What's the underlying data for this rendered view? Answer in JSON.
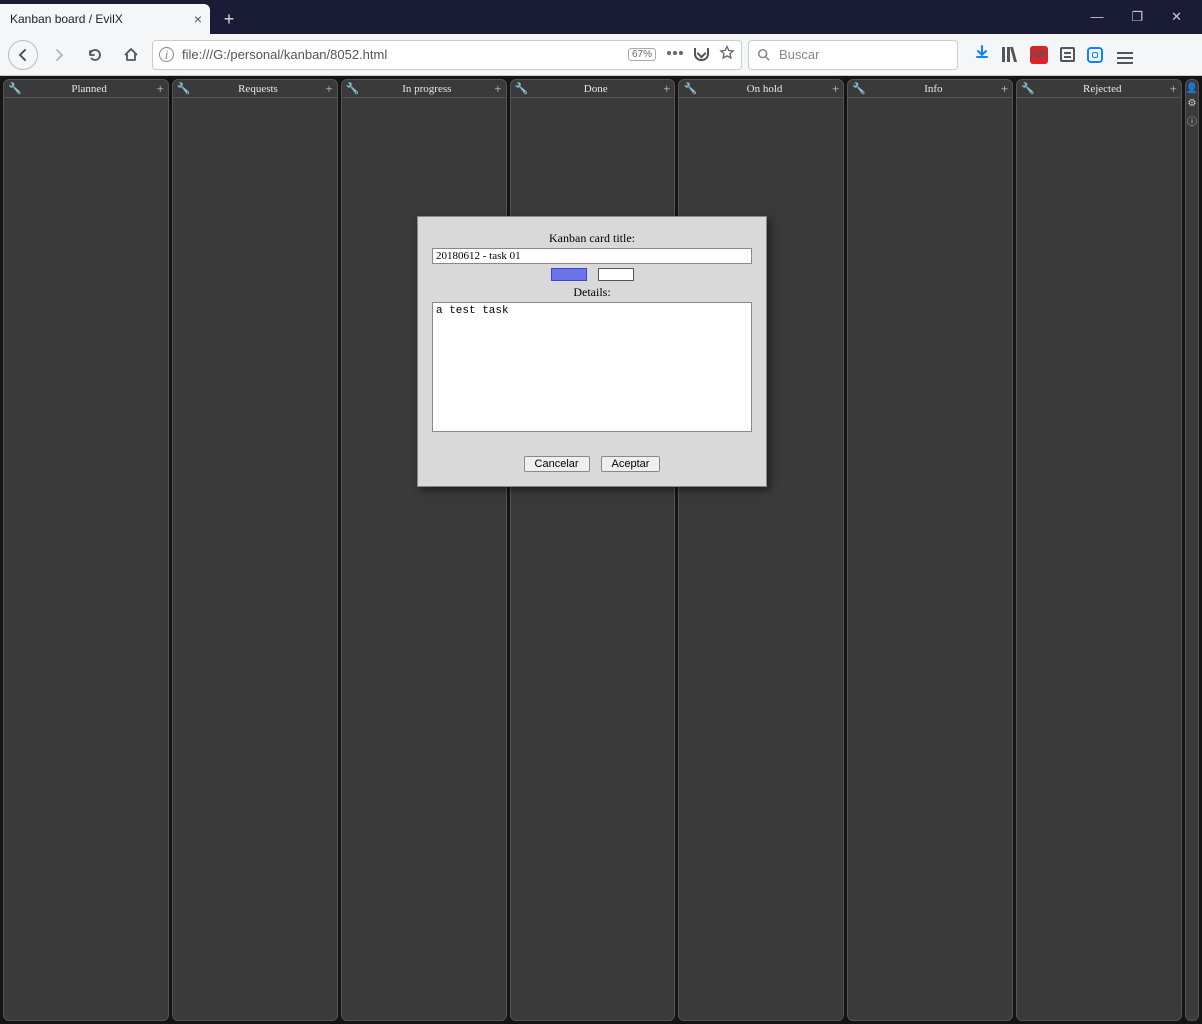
{
  "browser": {
    "tab_title": "Kanban board / EvilX",
    "url": "file:///G:/personal/kanban/8052.html",
    "zoom": "67%",
    "search_placeholder": "Buscar"
  },
  "board": {
    "columns": [
      {
        "name": "Planned"
      },
      {
        "name": "Requests"
      },
      {
        "name": "In progress"
      },
      {
        "name": "Done"
      },
      {
        "name": "On hold"
      },
      {
        "name": "Info"
      },
      {
        "name": "Rejected"
      }
    ]
  },
  "dialog": {
    "title_label": "Kanban card title:",
    "title_value": "20180612 - task 01",
    "details_label": "Details:",
    "details_value": "a test task",
    "cancel": "Cancelar",
    "accept": "Aceptar",
    "swatch_colors": [
      "#6b74e8",
      "#ffffff"
    ]
  }
}
